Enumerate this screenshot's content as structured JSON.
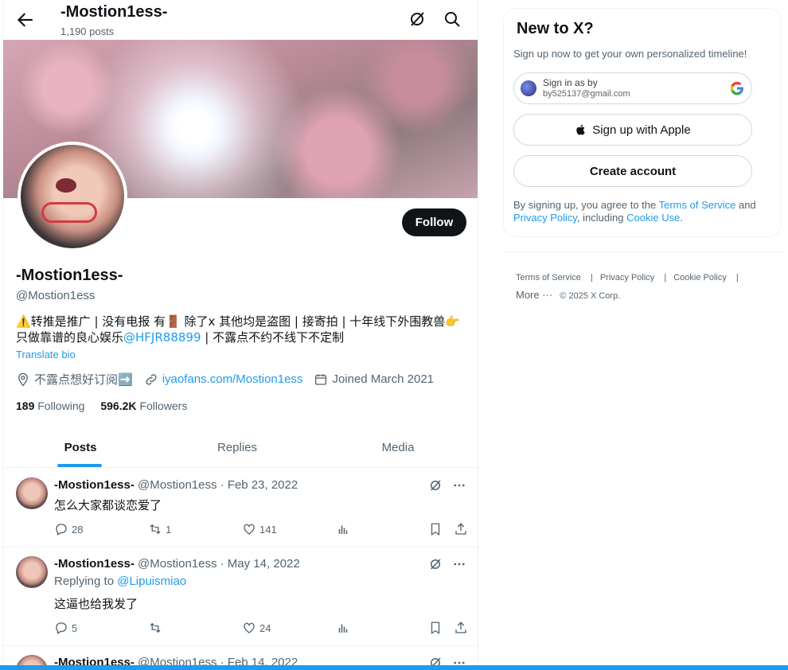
{
  "header": {
    "name": "-Mostion1ess-",
    "post_count": "1,190 posts"
  },
  "profile": {
    "follow_label": "Follow",
    "name": "-Mostion1ess-",
    "handle": "@Mostion1ess",
    "bio_pre": "⚠️转推是推广 | 没有电报 有🚪 除了x 其他均是盗图 | 接寄拍 | 十年线下外围教兽👉只做靠谱的良心娱乐",
    "bio_mention": "@HFJR88899",
    "bio_post": " | 不露点不约不线下不定制",
    "translate": "Translate bio",
    "location": "不露点想好订阅➡️",
    "website": "iyaofans.com/Mostion1ess",
    "joined": "Joined March 2021",
    "following_count": "189",
    "following_label": "Following",
    "followers_count": "596.2K",
    "followers_label": "Followers"
  },
  "tabs": [
    "Posts",
    "Replies",
    "Media"
  ],
  "tweets": [
    {
      "name": "-Mostion1ess-",
      "meta": "@Mostion1ess · Feb 23, 2022",
      "text": "怎么大家都谈恋爱了",
      "replies": "28",
      "retweets": "1",
      "likes": "141"
    },
    {
      "name": "-Mostion1ess-",
      "meta": "@Mostion1ess · May 14, 2022",
      "reply_prefix": "Replying to ",
      "reply_to": "@Lipuismiao",
      "text": "这逼也给我发了",
      "replies": "5",
      "retweets": "",
      "likes": "24"
    },
    {
      "name": "-Mostion1ess-",
      "meta": "@Mostion1ess · Feb 14, 2022"
    }
  ],
  "sidebar": {
    "title": "New to X?",
    "subtitle": "Sign up now to get your own personalized timeline!",
    "google_line1": "Sign in as by",
    "google_line2": "by525137@gmail.com",
    "apple_label": "Sign up with Apple",
    "create_label": "Create account",
    "legal_pre": "By signing up, you agree to the ",
    "legal_tos": "Terms of Service",
    "legal_and": " and ",
    "legal_privacy": "Privacy Policy",
    "legal_mid": ", including ",
    "legal_cookie": "Cookie Use",
    "legal_end": "."
  },
  "footer": {
    "terms": "Terms of Service",
    "privacy": "Privacy Policy",
    "cookie": "Cookie Policy",
    "more": "More ···",
    "copyright": "© 2025 X Corp."
  },
  "colors": {
    "accent": "#1d9bf0",
    "text": "#0f1419",
    "muted": "#536471"
  }
}
